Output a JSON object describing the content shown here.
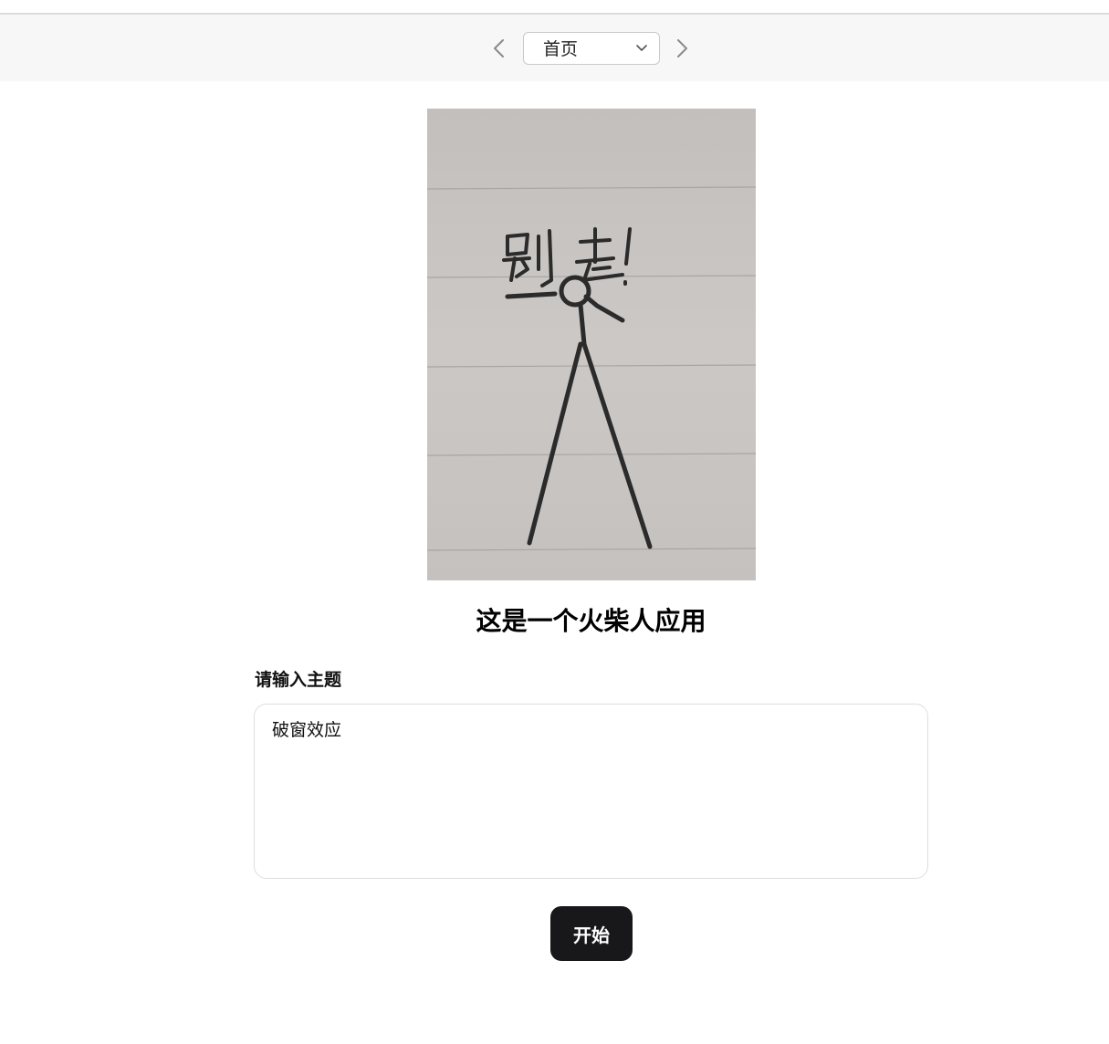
{
  "nav": {
    "prev_icon": "chevron-left-icon",
    "next_icon": "chevron-right-icon",
    "page_select": {
      "selected": "首页",
      "chevron_icon": "chevron-down-icon"
    }
  },
  "hero": {
    "image_subject": "hand-drawn stick figure on lined notebook paper",
    "handwritten_text": "别走!"
  },
  "main": {
    "title": "这是一个火柴人应用",
    "topic_label": "请输入主题",
    "topic_value": "破窗效应",
    "start_label": "开始"
  },
  "colors": {
    "navbar_bg": "#f7f7f7",
    "button_bg": "#18181b",
    "button_text": "#ffffff",
    "paper": "#c7c3c1",
    "ink": "#2b2b2b"
  }
}
